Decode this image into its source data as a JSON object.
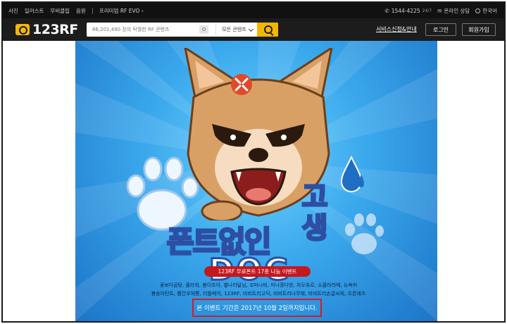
{
  "topbar": {
    "nav": [
      "사진",
      "일러스트",
      "무비클립",
      "음원"
    ],
    "evo": "프리미엄 RF EVO",
    "phone": "1544-4225",
    "support_hours": "24/7",
    "consult": "온라인 상담",
    "language": "한국어"
  },
  "header": {
    "logo": "123RF",
    "search_placeholder": "86,201,490 장의 탁월한 RF 콘텐츠",
    "select_value": "모든 콘텐츠",
    "service_link": "서비스신청&안내",
    "login": "로그인",
    "signup": "회원가입"
  },
  "banner": {
    "title_main": "폰트없인",
    "title_dog": "DOG",
    "title_side": "고생",
    "event_label": "123RF 무료폰트 17종 나눔 이벤트",
    "font_line_1": "꽃보다곰탕, 플라워, 봄이조아, 별나라달님, 꼬마나비, 미나콩다방, 차오츄르, 쇼콜라라떼, 뉴욕커",
    "font_line_2": "봉숭아틴트, 빨간우체통, 리틀베어, 123RF, 비비트리고딕, 비비트리나무체, 비비트리손글씨체, 오픈애즈",
    "period_notice": "본 이벤트 기간은 2017년 10월 2일까지입니다.",
    "colors": {
      "pill": "#c4181f",
      "title_yellow": "#ffd22e",
      "outline": "#2d4fa3",
      "highlight_box": "#d21c2c"
    }
  }
}
